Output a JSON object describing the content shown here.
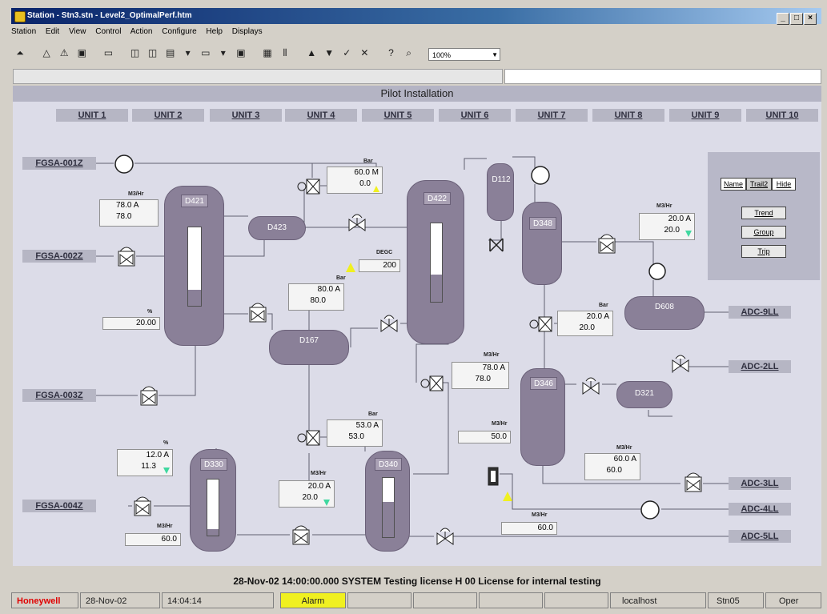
{
  "window": {
    "title": "Station - Stn3.stn - Level2_OptimalPerf.htm",
    "controls": [
      "_",
      "□",
      "×"
    ]
  },
  "menu": [
    "Station",
    "Edit",
    "View",
    "Control",
    "Action",
    "Configure",
    "Help",
    "Displays"
  ],
  "toolbar": {
    "zoom": "100%"
  },
  "display": {
    "title": "Pilot Installation",
    "units": [
      "UNIT 1",
      "UNIT 2",
      "UNIT 3",
      "UNIT 4",
      "UNIT 5",
      "UNIT 6",
      "UNIT 7",
      "UNIT 8",
      "UNIT 9",
      "UNIT 10"
    ],
    "feeds": [
      "FGSA-001Z",
      "FGSA-002Z",
      "FGSA-003Z",
      "FGSA-004Z"
    ],
    "outputs": [
      "ADC-9LL",
      "ADC-2LL",
      "ADC-3LL",
      "ADC-4LL",
      "ADC-5LL"
    ],
    "vessels": {
      "d421": "D421",
      "d423": "D423",
      "d167": "D167",
      "d422": "D422",
      "d112": "D112",
      "d348": "D348",
      "d608": "D608",
      "d346": "D346",
      "d321": "D321",
      "d330": "D330",
      "d340": "D340"
    },
    "levels": {
      "d421": 0.2,
      "d422": 0.35,
      "d330": 0.12,
      "d340": 0.6
    },
    "values": {
      "flow_d421": {
        "unit": "M3/Hr",
        "pv": "78.0 A",
        "sp": "78.0"
      },
      "pct_d421": {
        "unit": "%",
        "pv": "20.00"
      },
      "flow_top": {
        "unit": "Bar",
        "pv": "60.0 M",
        "sp": "0.0"
      },
      "degc": {
        "unit": "DEGC",
        "pv": "200"
      },
      "bar_mid": {
        "unit": "Bar",
        "pv": "80.0 A",
        "sp": "80.0"
      },
      "bar_d348": {
        "unit": "Bar",
        "pv": "20.0 A",
        "sp": "20.0"
      },
      "m3_right": {
        "unit": "M3/Hr",
        "pv": "20.0 A",
        "sp": "20.0"
      },
      "m3_d422": {
        "unit": "M3/Hr",
        "pv": "78.0 A",
        "sp": "78.0"
      },
      "m3_d346": {
        "unit": "M3/Hr",
        "pv": "50.0"
      },
      "bar_low": {
        "unit": "Bar",
        "pv": "53.0 A",
        "sp": "53.0"
      },
      "pct_d330": {
        "unit": "%",
        "pv": "12.0 A",
        "sp": "11.3"
      },
      "m3_d330": {
        "unit": "M3/Hr",
        "pv": "60.0"
      },
      "m3_mid2": {
        "unit": "M3/Hr",
        "pv": "20.0 A",
        "sp": "20.0"
      },
      "m3_d346b": {
        "unit": "M3/Hr",
        "pv": "60.0 A",
        "sp": "60.0"
      },
      "m3_bottom": {
        "unit": "M3/Hr",
        "pv": "60.0"
      }
    },
    "panel": {
      "tabs": [
        "Name",
        "Trail2",
        "Hide"
      ],
      "buttons": [
        "Trend",
        "Group",
        "Trip"
      ]
    }
  },
  "message": "28-Nov-02  14:00:00.000  SYSTEM  Testing license   H 00 License for internal testing",
  "status": {
    "brand": "Honeywell",
    "date": "28-Nov-02",
    "time": "14:04:14",
    "alarm": "Alarm",
    "host": "localhost",
    "station": "Stn05",
    "mode": "Oper"
  },
  "colors": {
    "vessel": "#8a8098",
    "alarm": "#f0f020",
    "brand": "#e00000",
    "green_indicator": "#40d8a0"
  }
}
